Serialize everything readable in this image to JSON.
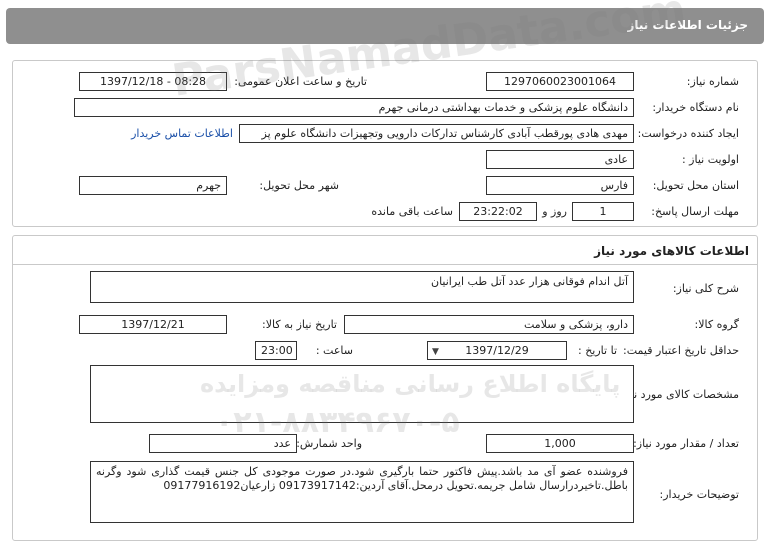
{
  "header": {
    "title": "جزئیات اطلاعات نیاز"
  },
  "need_info": {
    "need_number_label": "شماره نیاز:",
    "need_number": "1297060023001064",
    "announce_label": "تاریخ و ساعت اعلان عمومی:",
    "announce_value": "1397/12/18 - 08:28",
    "buyer_label": "نام دستگاه خریدار:",
    "buyer_value": "دانشگاه علوم پزشکی و خدمات بهداشتی درمانی جهرم",
    "requester_label": "ایجاد کننده درخواست:",
    "requester_value": "مهدی هادی پورقطب آبادی کارشناس تدارکات دارویی وتجهیزات دانشگاه علوم پز",
    "contact_link": "اطلاعات تماس خریدار",
    "priority_label": "اولویت نیاز :",
    "priority_value": "عادی",
    "province_label": "استان محل تحویل:",
    "province_value": "فارس",
    "city_label": "شهر محل تحویل:",
    "city_value": "جهرم",
    "deadline_label": "مهلت ارسال پاسخ:",
    "days_value": "1",
    "days_unit": "روز و",
    "time_value": "23:22:02",
    "remaining_text": "ساعت باقی مانده"
  },
  "goods": {
    "section_title": "اطلاعات کالاهای مورد نیاز",
    "summary_label": "شرح کلی نیاز:",
    "summary_value": "آتل اندام فوقانی  هزار عدد آتل طب ایرانیان",
    "group_label": "گروه کالا:",
    "group_value": "دارو، پزشکی و سلامت",
    "need_date_label": "تاریخ نیاز به کالا:",
    "need_date_value": "1397/12/21",
    "validity_label": "حداقل تاریخ اعتبار قیمت:",
    "to_date_label": "تا تاریخ :",
    "to_date_value": "1397/12/29",
    "hour_label": "ساعت :",
    "hour_value": "23:00",
    "specs_label": "مشخصات کالای مورد نیاز:",
    "specs_value": "",
    "qty_label": "تعداد / مقدار مورد نیاز:",
    "qty_value": "1,000",
    "unit_label": "واحد شمارش:",
    "unit_value": "عدد",
    "buyer_notes_label": "توضیحات خریدار:",
    "buyer_notes_value": "فروشنده عضو آی مد باشد.پیش فاکتور حتما بارگیری شود.در صورت موجودی کل جنس قیمت گذاری شود وگرنه باطل.تاخیردرارسال شامل جریمه.تحویل درمحل.آقای آردین:09173917142 زارعیان09177916192"
  },
  "watermark": {
    "site": "ParsNamadData.com",
    "line1": "پایگاه اطلاع رسانی مناقصه ومزایده",
    "phone": "۰۲۱-۸۸۳۴۹۶۷۰-۵"
  }
}
